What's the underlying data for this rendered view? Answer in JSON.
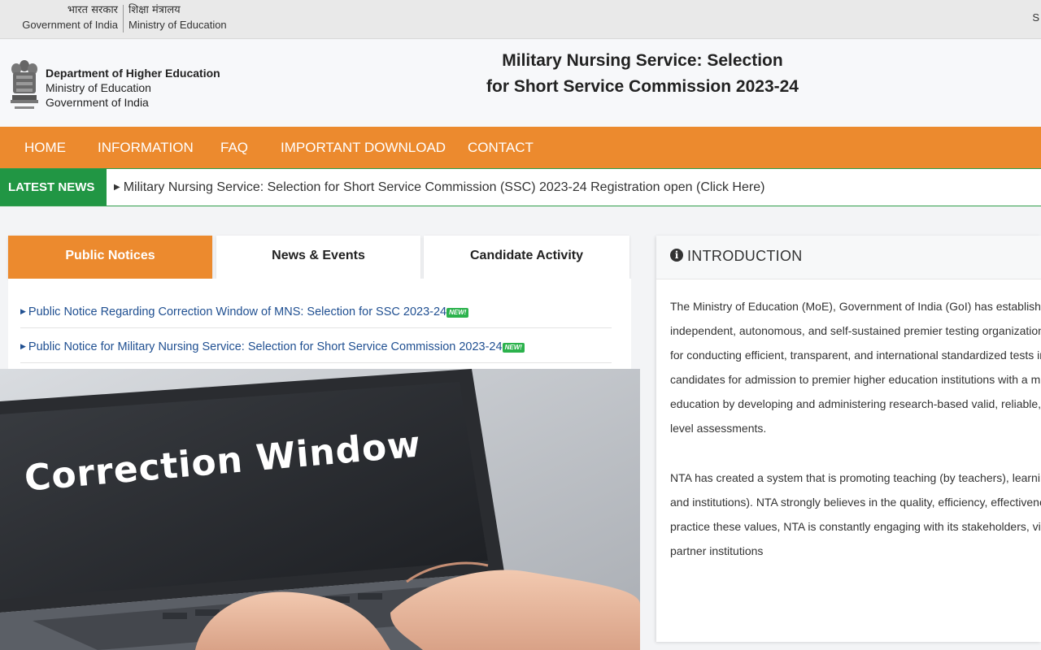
{
  "gov_strip": {
    "hindi_left": "भारत सरकार",
    "english_left": "Government of India",
    "hindi_right": "शिक्षा मंत्रालय",
    "english_right": "Ministry of Education",
    "extra": "S"
  },
  "header": {
    "dept_line1": "Department of Higher Education",
    "dept_line2": "Ministry of Education",
    "dept_line3": "Government of India",
    "title_line1": "Military Nursing Service: Selection",
    "title_line2": "for Short Service Commission 2023-24"
  },
  "nav": {
    "items": [
      {
        "label": "HOME"
      },
      {
        "label": "INFORMATION"
      },
      {
        "label": "FAQ"
      },
      {
        "label": "IMPORTANT DOWNLOAD"
      },
      {
        "label": "CONTACT"
      }
    ]
  },
  "news": {
    "label": "LATEST NEWS",
    "text": "Military Nursing Service: Selection for Short Service Commission (SSC) 2023-24 Registration open (Click Here)"
  },
  "tabs": [
    {
      "label": "Public Notices",
      "active": true
    },
    {
      "label": "News & Events",
      "active": false
    },
    {
      "label": "Candidate Activity",
      "active": false
    }
  ],
  "notices": [
    {
      "text": "Public Notice Regarding Correction Window of MNS: Selection for SSC 2023-24",
      "badge": "NEW!"
    },
    {
      "text": "Public Notice for Military Nursing Service: Selection for Short Service Commission 2023-24",
      "badge": "NEW!"
    }
  ],
  "promo": {
    "text": "Correction Window"
  },
  "intro": {
    "title": "INTRODUCTION",
    "p1": [
      "The Ministry of Education (MoE), Government of India (GoI) has established",
      "independent, autonomous, and self-sustained premier testing organization u",
      "for conducting efficient, transparent, and international standardized tests in c",
      "candidates for admission to premier higher education institutions with a miss",
      "education by developing and administering research-based valid, reliable, e",
      "level assessments."
    ],
    "p2": [
      "NTA has created a system that is promoting teaching (by teachers), learning",
      "and institutions). NTA strongly believes in the quality, efficiency, effectivenes",
      "practice these values, NTA is constantly engaging with its stakeholders, viz.",
      "partner institutions"
    ]
  },
  "colors": {
    "nav_orange": "#ec8a2e",
    "news_green": "#219644",
    "link_blue": "#1f4f91"
  }
}
